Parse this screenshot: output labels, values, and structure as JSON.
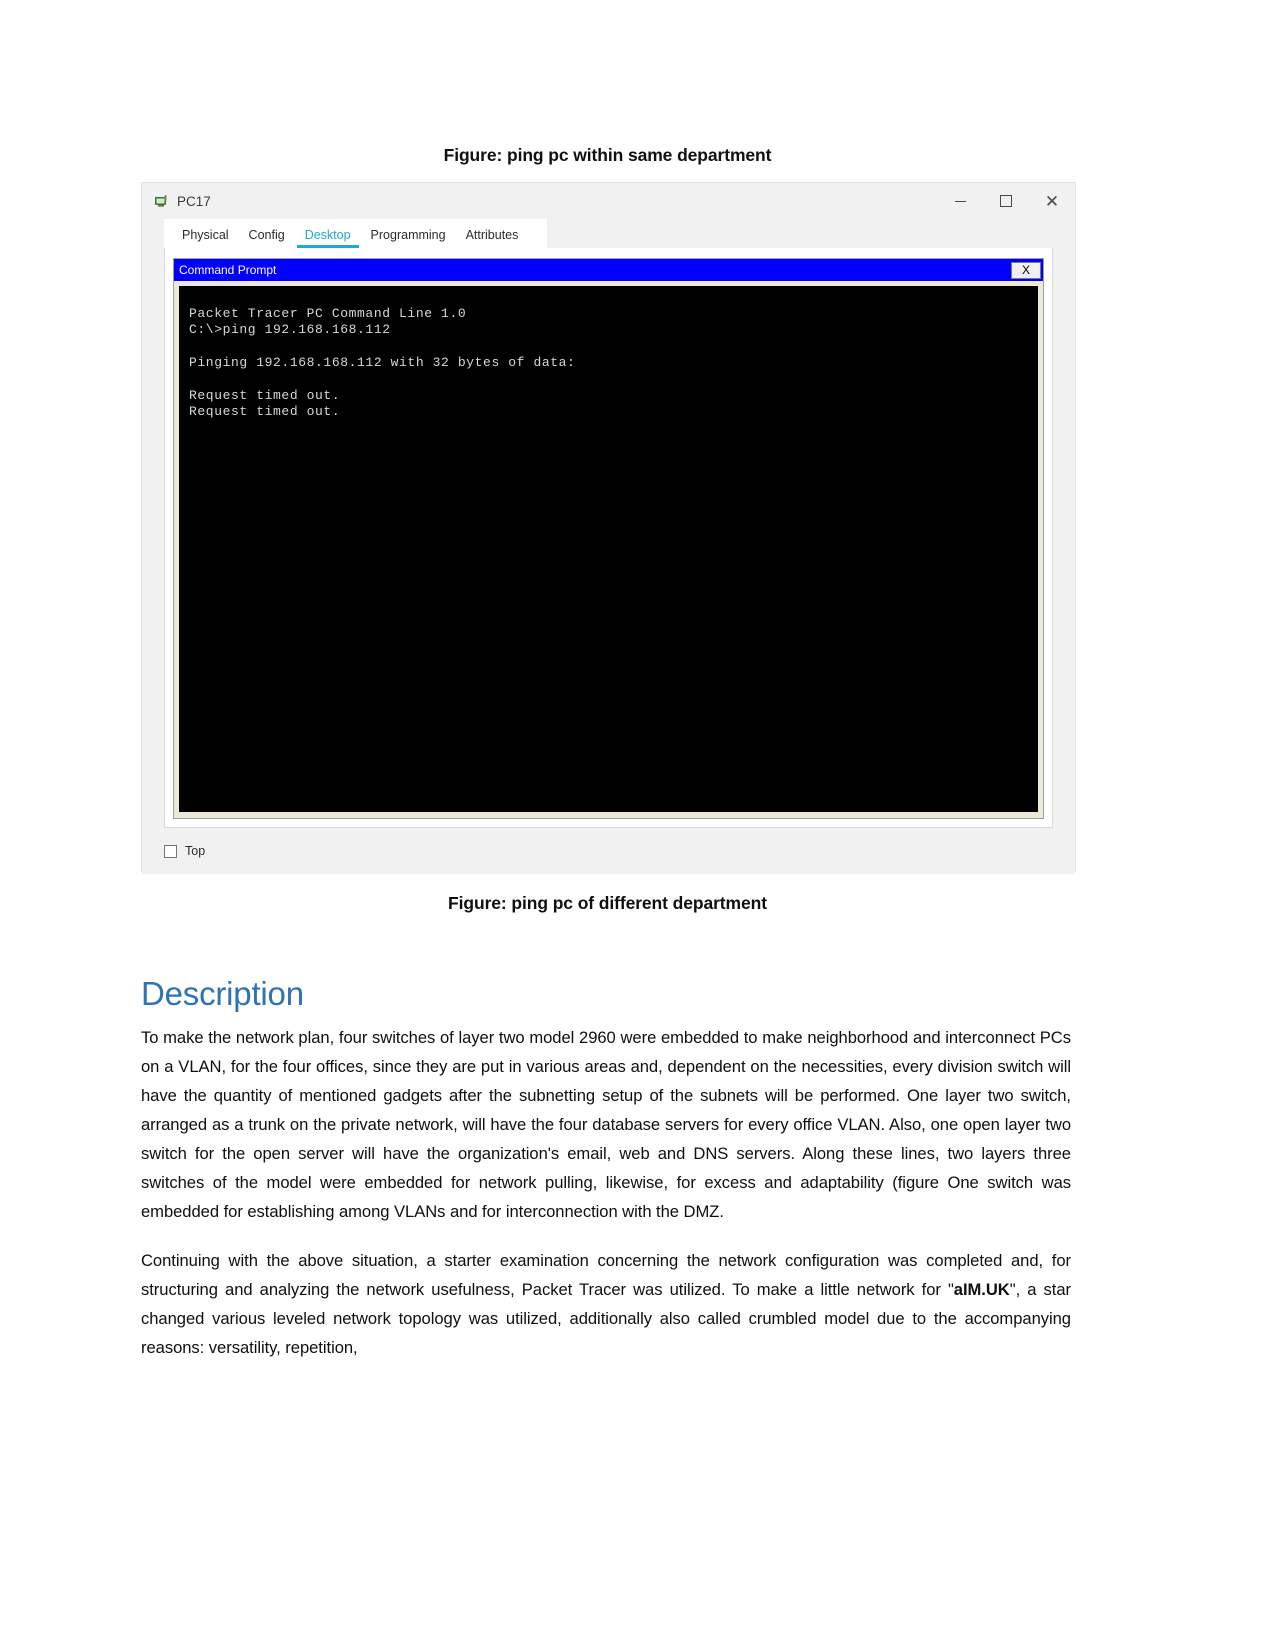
{
  "document": {
    "caption_top": "Figure: ping pc within same department",
    "caption_bottom": "Figure: ping pc of different department"
  },
  "window": {
    "title": "PC17",
    "icon": "packet-tracer-pc-icon",
    "controls": {
      "minimize": "–",
      "maximize": "□",
      "close": "✕"
    },
    "tabs": [
      {
        "label": "Physical",
        "active": false
      },
      {
        "label": "Config",
        "active": false
      },
      {
        "label": "Desktop",
        "active": true
      },
      {
        "label": "Programming",
        "active": false
      },
      {
        "label": "Attributes",
        "active": false
      }
    ],
    "active_tab_color": "#1ea7d8",
    "footer": {
      "checkbox_label": "Top",
      "checked": false
    }
  },
  "command_prompt": {
    "title": "Command Prompt",
    "titlebar_color": "#0000ff",
    "close_label": "X",
    "terminal_background": "#000000",
    "terminal_text_color": "#d7d7d7",
    "lines": [
      "Packet Tracer PC Command Line 1.0",
      "C:\\>ping 192.168.168.112",
      "",
      "Pinging 192.168.168.112 with 32 bytes of data:",
      "",
      "Request timed out.",
      "Request timed out."
    ]
  },
  "description": {
    "heading": "Description",
    "heading_color": "#2e74b5",
    "paragraph_1": "To make the network plan, four switches of layer two model 2960 were embedded to make neighborhood and interconnect PCs on a VLAN, for the four offices, since they are put in various areas and, dependent on the necessities, every division switch will have the quantity of mentioned gadgets after the subnetting setup of the subnets will be performed. One layer two switch, arranged as a trunk on the private network, will have the four database servers for every office VLAN.  Also, one open layer two switch for the open server will have the organization's email, web and DNS servers. Along these lines, two layers three switches of the model were embedded for network pulling, likewise, for excess and adaptability (figure One switch was embedded for establishing among VLANs and for interconnection with the DMZ.",
    "paragraph_2_part_1": "Continuing with the above situation, a starter examination concerning the network configuration was completed and, for structuring and analyzing the network usefulness, Packet Tracer was utilized. To make a little network for \"",
    "paragraph_2_bold": "aIM.UK",
    "paragraph_2_part_2": "\", a star changed various leveled network topology was utilized, additionally also called crumbled model due to the accompanying reasons: versatility, repetition,"
  }
}
